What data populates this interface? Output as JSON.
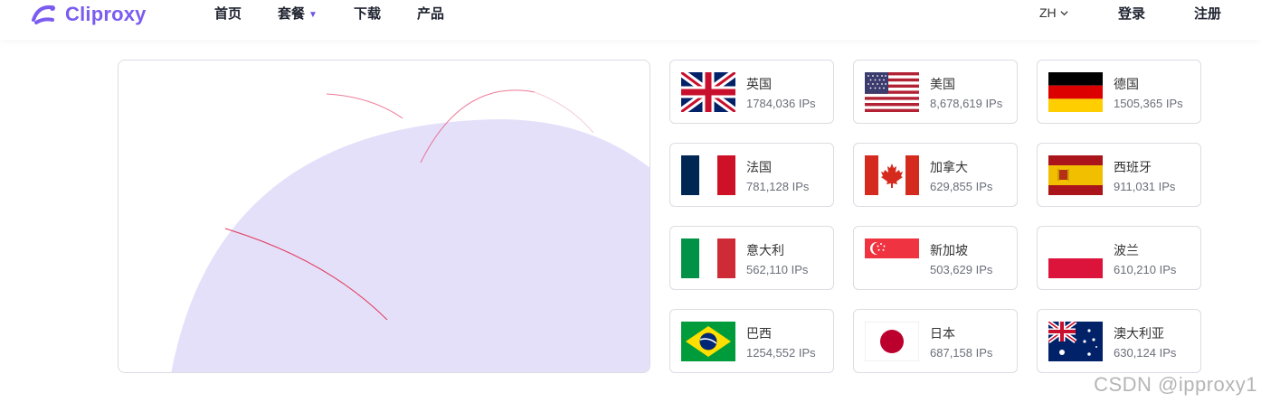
{
  "brand": {
    "name": "Cliproxy",
    "color": "#7b5cf0"
  },
  "nav": [
    {
      "label": "首页"
    },
    {
      "label": "套餐",
      "caret": "▼"
    },
    {
      "label": "下载"
    },
    {
      "label": "产品"
    }
  ],
  "header_right": {
    "lang": "ZH",
    "login": "登录",
    "register": "注册"
  },
  "countries": [
    {
      "name": "英国",
      "ips": "1784,036 IPs",
      "flag": "uk"
    },
    {
      "name": "美国",
      "ips": "8,678,619 IPs",
      "flag": "us"
    },
    {
      "name": "德国",
      "ips": "1505,365 IPs",
      "flag": "de"
    },
    {
      "name": "法国",
      "ips": "781,128 IPs",
      "flag": "fr"
    },
    {
      "name": "加拿大",
      "ips": "629,855 IPs",
      "flag": "ca"
    },
    {
      "name": "西班牙",
      "ips": "911,031 IPs",
      "flag": "es"
    },
    {
      "name": "意大利",
      "ips": "562,110 IPs",
      "flag": "it"
    },
    {
      "name": "新加坡",
      "ips": "503,629 IPs",
      "flag": "sg"
    },
    {
      "name": "波兰",
      "ips": "610,210 IPs",
      "flag": "pl"
    },
    {
      "name": "巴西",
      "ips": "1254,552 IPs",
      "flag": "br"
    },
    {
      "name": "日本",
      "ips": "687,158 IPs",
      "flag": "jp"
    },
    {
      "name": "澳大利亚",
      "ips": "630,124 IPs",
      "flag": "au"
    }
  ],
  "watermark": "CSDN @ipproxy1"
}
